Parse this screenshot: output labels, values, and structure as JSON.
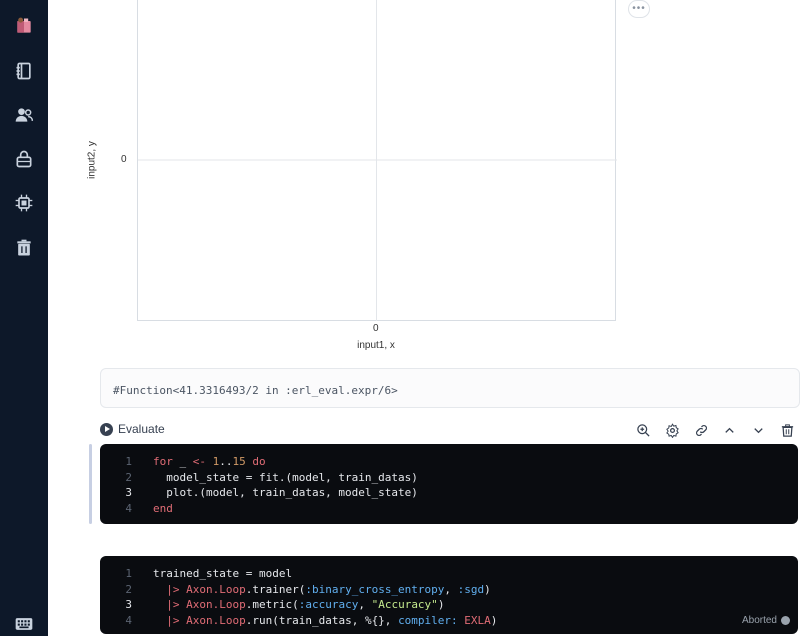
{
  "sidebar": {
    "items": [
      "logo-icon",
      "notebook-icon",
      "users-icon",
      "lock-icon",
      "chip-icon",
      "trash-icon",
      "keyboard-icon"
    ]
  },
  "chart_data": {
    "type": "scatter",
    "xlabel": "input1, x",
    "ylabel": "input2, y",
    "x_ticks": [
      "0"
    ],
    "y_ticks": [
      "0"
    ],
    "points": [],
    "grid": true
  },
  "output": {
    "text": "#Function<41.3316493/2 in :erl_eval.expr/6>"
  },
  "toolbar": {
    "evaluate_label": "Evaluate",
    "icons": [
      "zoom-icon",
      "settings-icon",
      "link-icon",
      "chevron-up-icon",
      "chevron-down-icon",
      "trash-icon"
    ]
  },
  "cell1": {
    "lines": [
      {
        "n": "1",
        "text": "for _ <- 1..15 do"
      },
      {
        "n": "2",
        "text": "  model_state = fit.(model, train_datas)"
      },
      {
        "n": "3",
        "text": "  plot.(model, train_datas, model_state)"
      },
      {
        "n": "4",
        "text": "end"
      }
    ]
  },
  "cell2": {
    "lines": [
      {
        "n": "1",
        "text": "trained_state = model"
      },
      {
        "n": "2",
        "text": "  |> Axon.Loop.trainer(:binary_cross_entropy, :sgd)"
      },
      {
        "n": "3",
        "text": "  |> Axon.Loop.metric(:accuracy, \"Accuracy\")"
      },
      {
        "n": "4",
        "text": "  |> Axon.Loop.run(train_datas, %{}, compiler: EXLA)"
      }
    ],
    "status": "Aborted"
  }
}
